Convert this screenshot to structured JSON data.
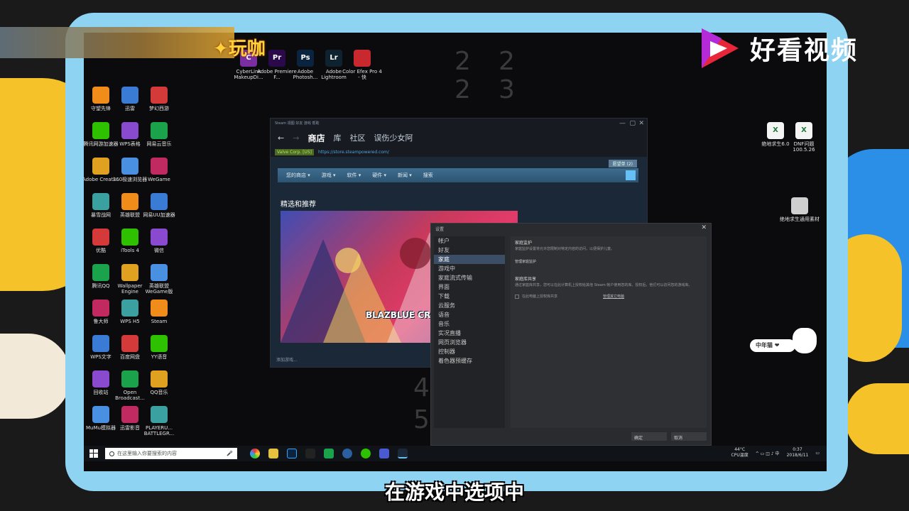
{
  "brand": {
    "logo_text": "玩咖",
    "site_name": "好看视频"
  },
  "subtitle": "在游戏中选项中",
  "desktop_top_icons": [
    {
      "label": "CyberLink MakeupDi...",
      "color": "#7a2fa0",
      "glyph": "C"
    },
    {
      "label": "Adobe Premiere F...",
      "color": "#2a0a4a",
      "glyph": "Pr"
    },
    {
      "label": "Adobe Photosh...",
      "color": "#0a2440",
      "glyph": "Ps"
    },
    {
      "label": "Adobe Lightroom",
      "color": "#0e2230",
      "glyph": "Lr"
    },
    {
      "label": "Color Efex Pro 4 - 快",
      "color": "#c8282e",
      "glyph": ""
    }
  ],
  "desktop_left_icons": [
    [
      "守望先锋",
      "迅雷",
      "梦幻西游"
    ],
    [
      "腾讯网游加速器",
      "WPS表格",
      "网易云音乐"
    ],
    [
      "Adobe Creati...",
      "360极速浏览器",
      "WeGame"
    ],
    [
      "暴雪战网",
      "英雄联盟",
      "网易UU加速器"
    ],
    [
      "优酷",
      "iTools 4",
      "微信"
    ],
    [
      "腾讯QQ",
      "Wallpaper Engine",
      "英雄联盟 WeGame版"
    ],
    [
      "鲁大师",
      "WPS H5",
      "Steam"
    ],
    [
      "WPS文字",
      "百度网盘",
      "YY语音"
    ],
    [
      "回收站",
      "Open Broadcast...",
      "QQ音乐"
    ],
    [
      "MuMu模拟器",
      "迅雷影音",
      "PLAYERU... BATTLEGR..."
    ]
  ],
  "desktop_right_icons": [
    {
      "label": "绝地求生6.0"
    },
    {
      "label": "DNF问题 100.5.26"
    },
    {
      "label": "绝地求生通用素材"
    }
  ],
  "steam": {
    "title_menu": "Steam  视图  好友  游戏  帮助",
    "nav": {
      "back": "←",
      "forward": "→",
      "store": "商店",
      "library": "库",
      "community": "社区",
      "user": "误伤少女阿"
    },
    "cert": "Valve Corp. [US]",
    "url": "https://store.steampowered.com/",
    "store_menu": [
      "您的商店 ▾",
      "游戏 ▾",
      "软件 ▾",
      "硬件 ▾",
      "新闻 ▾",
      "搜索"
    ],
    "featured": "精选和推荐",
    "game_title": "BLAZBLUE CROSS TAG BATTLE",
    "wishlist": "愿望单 (2)",
    "status": "添加游戏..."
  },
  "settings": {
    "title": "设置",
    "close": "✕",
    "items": [
      "帐户",
      "好友",
      "家庭",
      "游戏中",
      "家庭流式传输",
      "界面",
      "下载",
      "云服务",
      "语音",
      "音乐",
      "实况直播",
      "网页浏览器",
      "控制器",
      "着色器预缓存"
    ],
    "selected_index": 2,
    "section1_title": "家庭监护",
    "section1_text": "家庭监护设置将允许您限制对特定内容的访问，以便保护儿童。",
    "section1_link": "管理家庭监护",
    "section2_title": "家庭库共享",
    "section2_text": "通过家庭库共享，您可以在此计算机上授权给其他 Steam 帐户使用您的库。授权后，他们可以访问您的游戏库。",
    "section2_check": "在此电脑上授权库共享",
    "section2_link": "管理其它电脑",
    "ok": "确定",
    "cancel": "取消"
  },
  "taskbar": {
    "search_placeholder": "在这里输入你要搜索的内容",
    "temp": "44°C",
    "temp_label": "CPU温度",
    "time": "0:37",
    "date": "2018/6/11"
  },
  "cat_badge": "中年猫 ❤"
}
